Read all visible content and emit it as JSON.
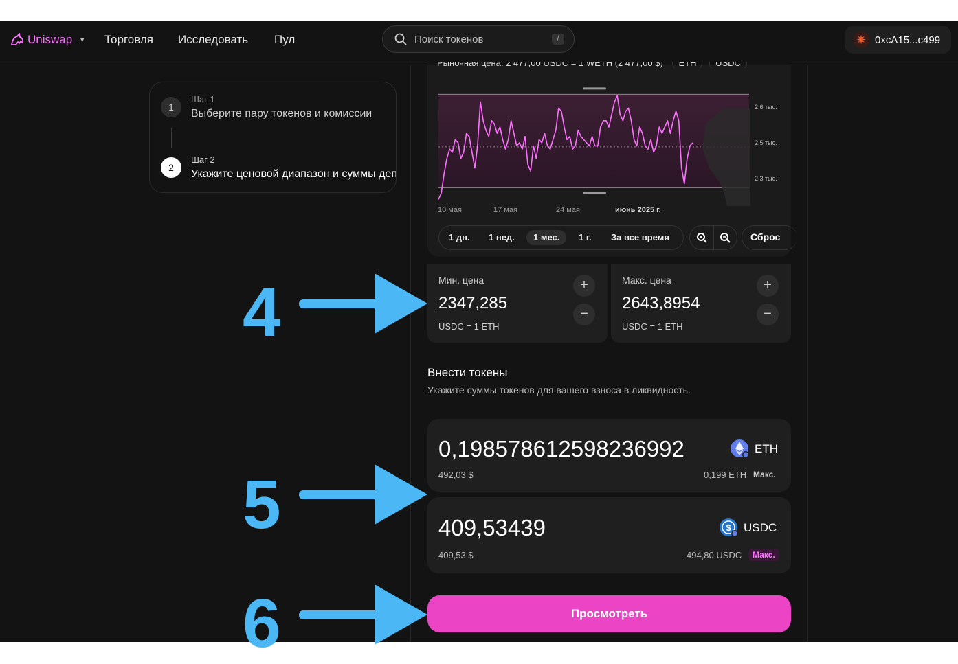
{
  "nav": {
    "brand": "Uniswap",
    "links": [
      "Торговля",
      "Исследовать",
      "Пул"
    ],
    "search_placeholder": "Поиск токенов",
    "search_shortcut": "/",
    "wallet_address": "0xcA15...c499"
  },
  "stepper": {
    "steps": [
      {
        "num": "1",
        "label": "Шаг 1",
        "title": "Выберите пару токенов и комиссии"
      },
      {
        "num": "2",
        "label": "Шаг 2",
        "title": "Укажите ценовой диапазон и суммы депозита"
      }
    ]
  },
  "chart": {
    "partial_header": "Рыночная цена: 2 477,00 USDC = 1 WETH (2 477,00 $)",
    "token_a": "ETH",
    "token_b": "USDC",
    "y_ticks": [
      "2,6 тыс.",
      "2,5 тыс.",
      "2,3 тыс."
    ],
    "date_labels": [
      "10 мая",
      "17 мая",
      "24 мая",
      "июнь 2025 г."
    ],
    "ranges": [
      "1 дн.",
      "1 нед.",
      "1 мес.",
      "1 г.",
      "За все время"
    ],
    "active_range": "1 мес.",
    "reset_label": "Сброс",
    "zoom_in": "zoom-in",
    "zoom_out": "zoom-out",
    "line_color": "#fc72ff"
  },
  "chart_data": {
    "type": "line",
    "title": "",
    "xlabel": "",
    "ylabel": "",
    "ylim": [
      2300,
      2660
    ],
    "range_min": 2347.285,
    "range_max": 2643.8954,
    "current": 2477,
    "y": [
      2310,
      2330,
      2390,
      2440,
      2470,
      2460,
      2500,
      2490,
      2440,
      2460,
      2520,
      2510,
      2460,
      2410,
      2480,
      2620,
      2560,
      2530,
      2510,
      2560,
      2550,
      2520,
      2540,
      2500,
      2470,
      2500,
      2560,
      2520,
      2480,
      2490,
      2470,
      2510,
      2420,
      2400,
      2480,
      2440,
      2500,
      2490,
      2520,
      2480,
      2470,
      2500,
      2530,
      2600,
      2590,
      2540,
      2500,
      2510,
      2470,
      2480,
      2530,
      2510,
      2500,
      2490,
      2480,
      2510,
      2480,
      2480,
      2540,
      2560,
      2560,
      2540,
      2580,
      2620,
      2640,
      2580,
      2560,
      2590,
      2600,
      2560,
      2500,
      2480,
      2540,
      2520,
      2480,
      2470,
      2500,
      2460,
      2480,
      2540,
      2520,
      2540,
      2560,
      2520,
      2560,
      2590,
      2560,
      2410,
      2360,
      2440,
      2480,
      2490
    ]
  },
  "min_price": {
    "label": "Мин. цена",
    "value": "2347,285",
    "unit": "USDC = 1 ETH",
    "plus": "+",
    "minus": "−"
  },
  "max_price": {
    "label": "Макс. цена",
    "value": "2643,8954",
    "unit": "USDC = 1 ETH",
    "plus": "+",
    "minus": "−"
  },
  "deposit": {
    "title": "Внести токены",
    "subtitle": "Укажите суммы токенов для вашего взноса в ликвидность."
  },
  "token_eth": {
    "amount": "0,198578612598236992",
    "usd": "492,03 $",
    "symbol": "ETH",
    "balance": "0,199 ETH",
    "max": "Макс."
  },
  "token_usdc": {
    "amount": "409,53439",
    "usd": "409,53 $",
    "symbol": "USDC",
    "balance": "494,80 USDC",
    "max": "Макс."
  },
  "review_button": "Просмотреть",
  "annotations": [
    "4",
    "5",
    "6"
  ],
  "colors": {
    "accent": "#fc72ff",
    "button": "#eb44c5",
    "annotation": "#4bb8f5"
  }
}
